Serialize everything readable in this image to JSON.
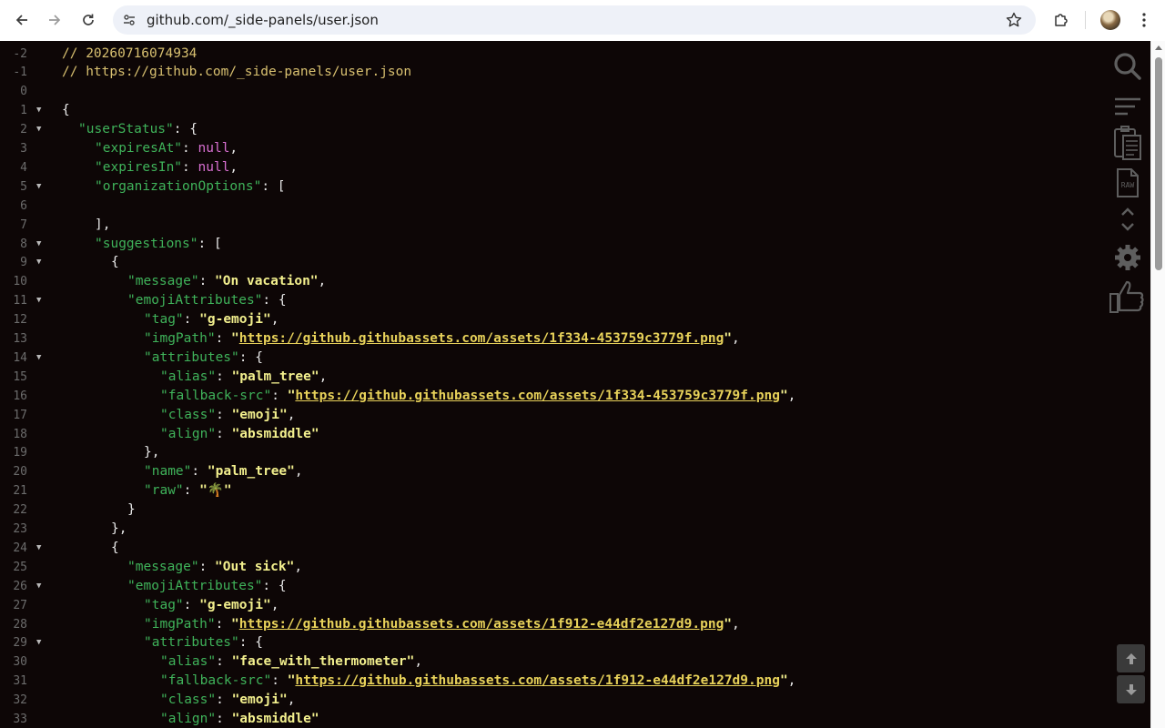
{
  "browser": {
    "url": "github.com/_side-panels/user.json"
  },
  "comments": {
    "timestamp": "// 20260716074934",
    "source": "// https://github.com/_side-panels/user.json"
  },
  "lines": [
    {
      "n": "-2",
      "fold": false,
      "indent": 0,
      "t": [
        [
          "cm",
          "// 20260716074934"
        ]
      ]
    },
    {
      "n": "-1",
      "fold": false,
      "indent": 0,
      "t": [
        [
          "cm",
          "// https://github.com/_side-panels/user.json"
        ]
      ]
    },
    {
      "n": "0",
      "fold": false,
      "indent": 0,
      "t": []
    },
    {
      "n": "1",
      "fold": true,
      "indent": 0,
      "t": [
        [
          "p",
          "{"
        ]
      ]
    },
    {
      "n": "2",
      "fold": true,
      "indent": 1,
      "t": [
        [
          "k",
          "\"userStatus\""
        ],
        [
          "p",
          ": {"
        ]
      ]
    },
    {
      "n": "3",
      "fold": false,
      "indent": 2,
      "t": [
        [
          "k",
          "\"expiresAt\""
        ],
        [
          "p",
          ": "
        ],
        [
          "n",
          "null"
        ],
        [
          "p",
          ","
        ]
      ]
    },
    {
      "n": "4",
      "fold": false,
      "indent": 2,
      "t": [
        [
          "k",
          "\"expiresIn\""
        ],
        [
          "p",
          ": "
        ],
        [
          "n",
          "null"
        ],
        [
          "p",
          ","
        ]
      ]
    },
    {
      "n": "5",
      "fold": true,
      "indent": 2,
      "t": [
        [
          "k",
          "\"organizationOptions\""
        ],
        [
          "p",
          ": ["
        ]
      ]
    },
    {
      "n": "6",
      "fold": false,
      "indent": 2,
      "t": []
    },
    {
      "n": "7",
      "fold": false,
      "indent": 2,
      "t": [
        [
          "p",
          "],"
        ]
      ]
    },
    {
      "n": "8",
      "fold": true,
      "indent": 2,
      "t": [
        [
          "k",
          "\"suggestions\""
        ],
        [
          "p",
          ": ["
        ]
      ]
    },
    {
      "n": "9",
      "fold": true,
      "indent": 3,
      "t": [
        [
          "p",
          "{"
        ]
      ]
    },
    {
      "n": "10",
      "fold": false,
      "indent": 4,
      "t": [
        [
          "k",
          "\"message\""
        ],
        [
          "p",
          ": "
        ],
        [
          "s",
          "\"On vacation\""
        ],
        [
          "p",
          ","
        ]
      ]
    },
    {
      "n": "11",
      "fold": true,
      "indent": 4,
      "t": [
        [
          "k",
          "\"emojiAttributes\""
        ],
        [
          "p",
          ": {"
        ]
      ]
    },
    {
      "n": "12",
      "fold": false,
      "indent": 5,
      "t": [
        [
          "k",
          "\"tag\""
        ],
        [
          "p",
          ": "
        ],
        [
          "s",
          "\"g-emoji\""
        ],
        [
          "p",
          ","
        ]
      ]
    },
    {
      "n": "13",
      "fold": false,
      "indent": 5,
      "t": [
        [
          "k",
          "\"imgPath\""
        ],
        [
          "p",
          ": "
        ],
        [
          "s",
          "\""
        ],
        [
          "u",
          "https://github.githubassets.com/assets/1f334-453759c3779f.png"
        ],
        [
          "s",
          "\""
        ],
        [
          "p",
          ","
        ]
      ]
    },
    {
      "n": "14",
      "fold": true,
      "indent": 5,
      "t": [
        [
          "k",
          "\"attributes\""
        ],
        [
          "p",
          ": {"
        ]
      ]
    },
    {
      "n": "15",
      "fold": false,
      "indent": 6,
      "t": [
        [
          "k",
          "\"alias\""
        ],
        [
          "p",
          ": "
        ],
        [
          "s",
          "\"palm_tree\""
        ],
        [
          "p",
          ","
        ]
      ]
    },
    {
      "n": "16",
      "fold": false,
      "indent": 6,
      "t": [
        [
          "k",
          "\"fallback-src\""
        ],
        [
          "p",
          ": "
        ],
        [
          "s",
          "\""
        ],
        [
          "u",
          "https://github.githubassets.com/assets/1f334-453759c3779f.png"
        ],
        [
          "s",
          "\""
        ],
        [
          "p",
          ","
        ]
      ]
    },
    {
      "n": "17",
      "fold": false,
      "indent": 6,
      "t": [
        [
          "k",
          "\"class\""
        ],
        [
          "p",
          ": "
        ],
        [
          "s",
          "\"emoji\""
        ],
        [
          "p",
          ","
        ]
      ]
    },
    {
      "n": "18",
      "fold": false,
      "indent": 6,
      "t": [
        [
          "k",
          "\"align\""
        ],
        [
          "p",
          ": "
        ],
        [
          "s",
          "\"absmiddle\""
        ]
      ]
    },
    {
      "n": "19",
      "fold": false,
      "indent": 5,
      "t": [
        [
          "p",
          "},"
        ]
      ]
    },
    {
      "n": "20",
      "fold": false,
      "indent": 5,
      "t": [
        [
          "k",
          "\"name\""
        ],
        [
          "p",
          ": "
        ],
        [
          "s",
          "\"palm_tree\""
        ],
        [
          "p",
          ","
        ]
      ]
    },
    {
      "n": "21",
      "fold": false,
      "indent": 5,
      "t": [
        [
          "k",
          "\"raw\""
        ],
        [
          "p",
          ": "
        ],
        [
          "s",
          "\"🌴\""
        ]
      ]
    },
    {
      "n": "22",
      "fold": false,
      "indent": 4,
      "t": [
        [
          "p",
          "}"
        ]
      ]
    },
    {
      "n": "23",
      "fold": false,
      "indent": 3,
      "t": [
        [
          "p",
          "},"
        ]
      ]
    },
    {
      "n": "24",
      "fold": true,
      "indent": 3,
      "t": [
        [
          "p",
          "{"
        ]
      ]
    },
    {
      "n": "25",
      "fold": false,
      "indent": 4,
      "t": [
        [
          "k",
          "\"message\""
        ],
        [
          "p",
          ": "
        ],
        [
          "s",
          "\"Out sick\""
        ],
        [
          "p",
          ","
        ]
      ]
    },
    {
      "n": "26",
      "fold": true,
      "indent": 4,
      "t": [
        [
          "k",
          "\"emojiAttributes\""
        ],
        [
          "p",
          ": {"
        ]
      ]
    },
    {
      "n": "27",
      "fold": false,
      "indent": 5,
      "t": [
        [
          "k",
          "\"tag\""
        ],
        [
          "p",
          ": "
        ],
        [
          "s",
          "\"g-emoji\""
        ],
        [
          "p",
          ","
        ]
      ]
    },
    {
      "n": "28",
      "fold": false,
      "indent": 5,
      "t": [
        [
          "k",
          "\"imgPath\""
        ],
        [
          "p",
          ": "
        ],
        [
          "s",
          "\""
        ],
        [
          "u",
          "https://github.githubassets.com/assets/1f912-e44df2e127d9.png"
        ],
        [
          "s",
          "\""
        ],
        [
          "p",
          ","
        ]
      ]
    },
    {
      "n": "29",
      "fold": true,
      "indent": 5,
      "t": [
        [
          "k",
          "\"attributes\""
        ],
        [
          "p",
          ": {"
        ]
      ]
    },
    {
      "n": "30",
      "fold": false,
      "indent": 6,
      "t": [
        [
          "k",
          "\"alias\""
        ],
        [
          "p",
          ": "
        ],
        [
          "s",
          "\"face_with_thermometer\""
        ],
        [
          "p",
          ","
        ]
      ]
    },
    {
      "n": "31",
      "fold": false,
      "indent": 6,
      "t": [
        [
          "k",
          "\"fallback-src\""
        ],
        [
          "p",
          ": "
        ],
        [
          "s",
          "\""
        ],
        [
          "u",
          "https://github.githubassets.com/assets/1f912-e44df2e127d9.png"
        ],
        [
          "s",
          "\""
        ],
        [
          "p",
          ","
        ]
      ]
    },
    {
      "n": "32",
      "fold": false,
      "indent": 6,
      "t": [
        [
          "k",
          "\"class\""
        ],
        [
          "p",
          ": "
        ],
        [
          "s",
          "\"emoji\""
        ],
        [
          "p",
          ","
        ]
      ]
    },
    {
      "n": "33",
      "fold": false,
      "indent": 6,
      "t": [
        [
          "k",
          "\"align\""
        ],
        [
          "p",
          ": "
        ],
        [
          "s",
          "\"absmiddle\""
        ]
      ]
    }
  ],
  "tools": {
    "search": "search-icon",
    "format": "format-lines-icon",
    "copy": "clipboard-icon",
    "raw": "raw-file-icon",
    "raw_label": "RAW",
    "collapse": "collapse-expand-icon",
    "settings": "gear-icon",
    "feedback": "thumbs-up-icon"
  },
  "colors": {
    "background": "#0d0606",
    "key": "#3fb35a",
    "string": "#f3f08e",
    "null": "#d86fd1",
    "link": "#e8d25a",
    "comment": "#d8c070"
  }
}
